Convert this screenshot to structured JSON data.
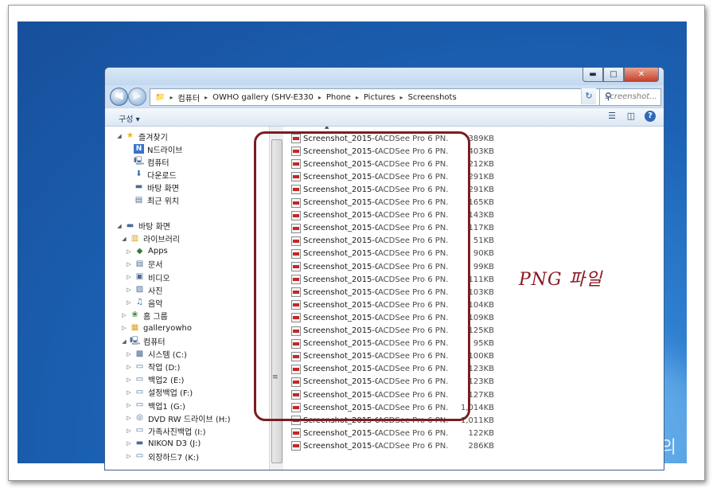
{
  "address": {
    "crumbs": [
      "컴퓨터",
      "OWHO gallery (SHV-E330",
      "Phone",
      "Pictures",
      "Screenshots"
    ],
    "search_placeholder": "Screenshot..."
  },
  "toolbar": {
    "organize_label": "구성 ▾"
  },
  "window_buttons": {
    "minimize": "▬",
    "maximize": "□",
    "close": "✕"
  },
  "nav": {
    "favorites": {
      "label": "즐겨찾기",
      "icon": "star-icon"
    },
    "fav_items": [
      {
        "label": "N드라이브",
        "icon": "ndrive-icon"
      },
      {
        "label": "컴퓨터",
        "icon": "computer-icon"
      },
      {
        "label": "다운로드",
        "icon": "download-icon"
      },
      {
        "label": "바탕 화면",
        "icon": "desktop-icon"
      },
      {
        "label": "최근 위치",
        "icon": "recent-places-icon"
      }
    ],
    "desktop": {
      "label": "바탕 화면",
      "icon": "desktop-icon"
    },
    "libraries": {
      "label": "라이브러리",
      "icon": "library-icon"
    },
    "library_items": [
      {
        "label": "Apps",
        "icon": "apps-icon"
      },
      {
        "label": "문서",
        "icon": "document-icon"
      },
      {
        "label": "비디오",
        "icon": "video-icon"
      },
      {
        "label": "사진",
        "icon": "picture-icon"
      },
      {
        "label": "음악",
        "icon": "music-icon"
      }
    ],
    "homegroup": {
      "label": "홈 그룹",
      "icon": "homegroup-icon"
    },
    "user": {
      "label": "galleryowho",
      "icon": "user-folder-icon"
    },
    "computer": {
      "label": "컴퓨터",
      "icon": "computer-icon"
    },
    "drives": [
      {
        "label": "시스템 (C:)",
        "icon": "system-drive-icon"
      },
      {
        "label": "작업 (D:)",
        "icon": "drive-icon"
      },
      {
        "label": "백업2 (E:)",
        "icon": "drive-icon"
      },
      {
        "label": "설정백업 (F:)",
        "icon": "drive-icon"
      },
      {
        "label": "백업1 (G:)",
        "icon": "drive-icon"
      },
      {
        "label": "DVD RW 드라이브 (H:)",
        "icon": "dvd-icon"
      },
      {
        "label": "가족사진백업 (I:)",
        "icon": "drive-icon"
      },
      {
        "label": "NIKON D3 (J:)",
        "icon": "camera-drive-icon"
      },
      {
        "label": "외장하드7 (K:)",
        "icon": "drive-icon"
      }
    ]
  },
  "files": [
    {
      "name": "Screenshot_2015-0...",
      "type": "ACDSee Pro 6 PN...",
      "size": "389KB"
    },
    {
      "name": "Screenshot_2015-0...",
      "type": "ACDSee Pro 6 PN...",
      "size": "403KB"
    },
    {
      "name": "Screenshot_2015-0...",
      "type": "ACDSee Pro 6 PN...",
      "size": "212KB"
    },
    {
      "name": "Screenshot_2015-0...",
      "type": "ACDSee Pro 6 PN...",
      "size": "291KB"
    },
    {
      "name": "Screenshot_2015-0...",
      "type": "ACDSee Pro 6 PN...",
      "size": "291KB"
    },
    {
      "name": "Screenshot_2015-0...",
      "type": "ACDSee Pro 6 PN...",
      "size": "165KB"
    },
    {
      "name": "Screenshot_2015-0...",
      "type": "ACDSee Pro 6 PN...",
      "size": "143KB"
    },
    {
      "name": "Screenshot_2015-0...",
      "type": "ACDSee Pro 6 PN...",
      "size": "117KB"
    },
    {
      "name": "Screenshot_2015-0...",
      "type": "ACDSee Pro 6 PN...",
      "size": "51KB"
    },
    {
      "name": "Screenshot_2015-0...",
      "type": "ACDSee Pro 6 PN...",
      "size": "90KB"
    },
    {
      "name": "Screenshot_2015-0...",
      "type": "ACDSee Pro 6 PN...",
      "size": "99KB"
    },
    {
      "name": "Screenshot_2015-0...",
      "type": "ACDSee Pro 6 PN...",
      "size": "111KB"
    },
    {
      "name": "Screenshot_2015-0...",
      "type": "ACDSee Pro 6 PN...",
      "size": "103KB"
    },
    {
      "name": "Screenshot_2015-0...",
      "type": "ACDSee Pro 6 PN...",
      "size": "104KB"
    },
    {
      "name": "Screenshot_2015-0...",
      "type": "ACDSee Pro 6 PN...",
      "size": "109KB"
    },
    {
      "name": "Screenshot_2015-0...",
      "type": "ACDSee Pro 6 PN...",
      "size": "125KB"
    },
    {
      "name": "Screenshot_2015-0...",
      "type": "ACDSee Pro 6 PN...",
      "size": "95KB"
    },
    {
      "name": "Screenshot_2015-0...",
      "type": "ACDSee Pro 6 PN...",
      "size": "100KB"
    },
    {
      "name": "Screenshot_2015-0...",
      "type": "ACDSee Pro 6 PN...",
      "size": "123KB"
    },
    {
      "name": "Screenshot_2015-0...",
      "type": "ACDSee Pro 6 PN...",
      "size": "123KB"
    },
    {
      "name": "Screenshot_2015-0...",
      "type": "ACDSee Pro 6 PN...",
      "size": "127KB"
    },
    {
      "name": "Screenshot_2015-0...",
      "type": "ACDSee Pro 6 PN...",
      "size": "1,014KB"
    },
    {
      "name": "Screenshot_2015-0...",
      "type": "ACDSee Pro 6 PN...",
      "size": "1,011KB"
    },
    {
      "name": "Screenshot_2015-0...",
      "type": "ACDSee Pro 6 PN...",
      "size": "122KB"
    },
    {
      "name": "Screenshot_2015-0...",
      "type": "ACDSee Pro 6 PN...",
      "size": "286KB"
    }
  ],
  "annotation": {
    "text": "PNG 파일",
    "color": "#8a1822"
  },
  "desktop_watermark": "의"
}
